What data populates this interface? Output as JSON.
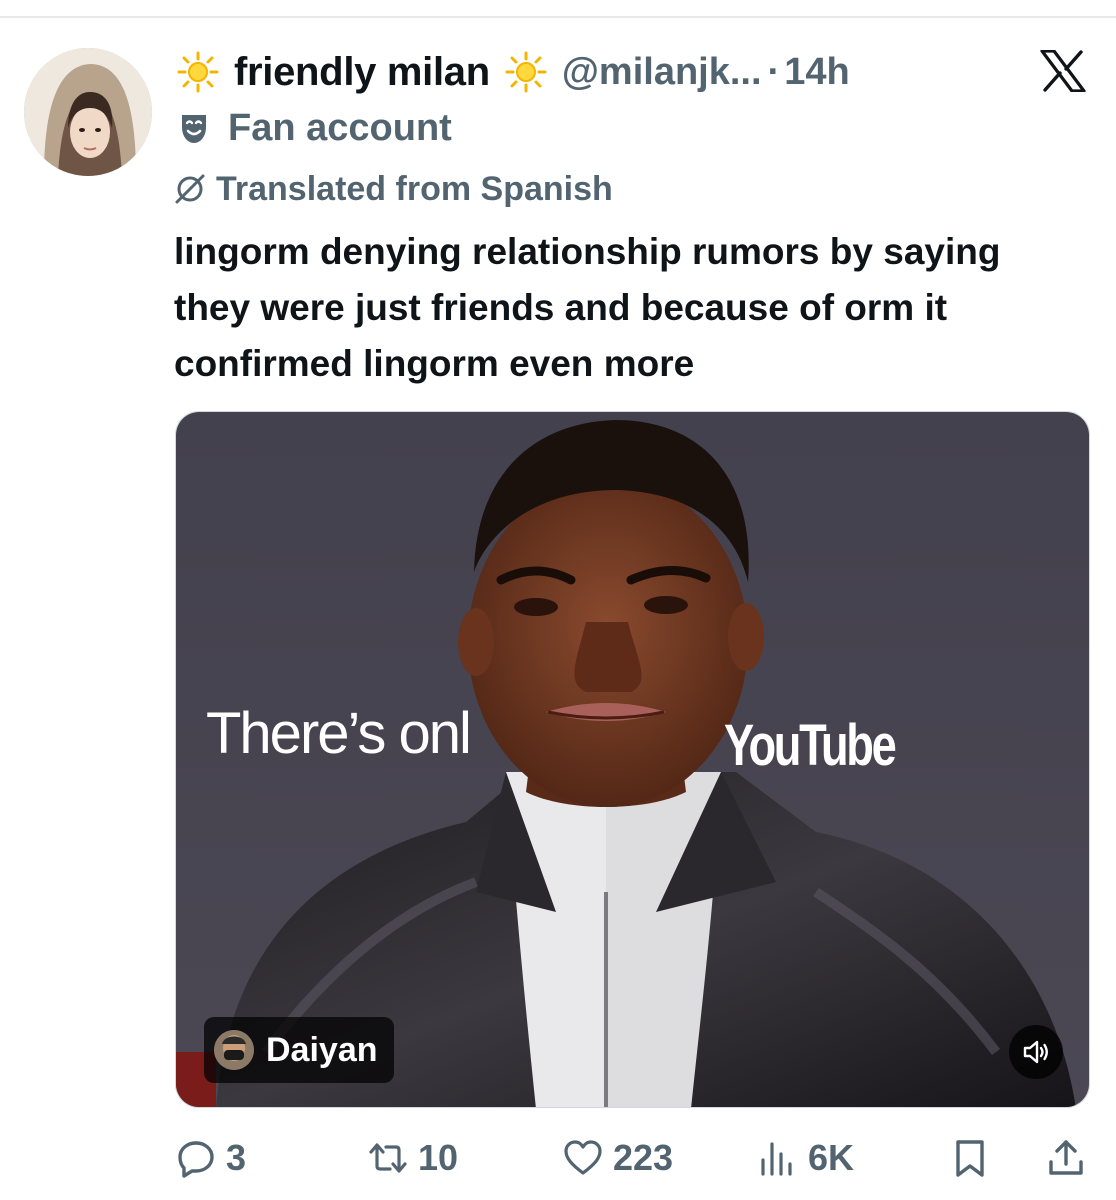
{
  "tweet": {
    "display_name": "friendly milan",
    "handle": "@milanjk...",
    "separator": "·",
    "time": "14h",
    "badge_label": "Fan account",
    "translated_label": "Translated from Spanish",
    "text": "lingorm denying relationship rumors by saying they were just friends and because of orm it confirmed lingorm even more"
  },
  "media": {
    "sign_left_text": "There’s onl",
    "sign_right_text": "YouTube",
    "credit_name": "Daiyan"
  },
  "actions": {
    "replies": "3",
    "reposts": "10",
    "likes": "223",
    "views": "6K"
  },
  "icons": {
    "emoji_left": "sun-emoji-icon",
    "emoji_right": "sun-emoji-icon",
    "badge": "theater-masks-icon",
    "translate": "translate-icon",
    "logo": "x-logo-icon",
    "sound": "speaker-icon",
    "reply": "reply-icon",
    "repost": "repost-icon",
    "like": "heart-icon",
    "views": "views-bar-chart-icon",
    "bookmark": "bookmark-icon",
    "share": "share-icon"
  },
  "colors": {
    "text_primary": "#0f1419",
    "text_secondary": "#536471",
    "divider": "#e7e9ea",
    "background": "#ffffff"
  }
}
